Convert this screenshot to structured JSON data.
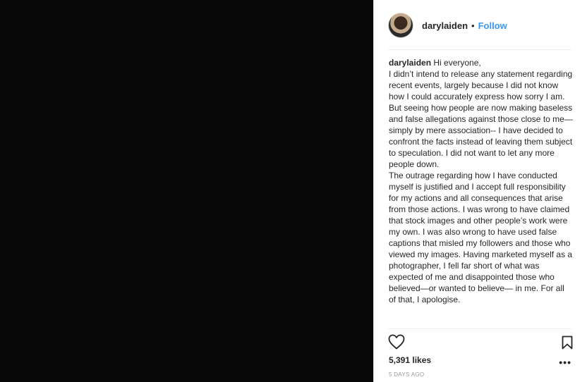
{
  "post": {
    "username": "darylaiden",
    "separator": "•",
    "follow_label": "Follow",
    "caption_username": "darylaiden",
    "caption_paragraphs": [
      "Hi everyone,",
      "I didn’t intend to release any statement regarding recent events, largely because I did not know how I could accurately express how sorry I am. But seeing how people are now making baseless and false allegations against those close to me—simply by mere association-- I have decided to confront the facts instead of leaving them subject to speculation. I did not want to let any more people down.",
      "The outrage regarding how I have conducted myself is justified and I accept full responsibility for my actions and all consequences that arise from those actions. I was wrong to have claimed that stock images and other people’s work were my own. I was also wrong to have used false captions that misled my followers and those who viewed my images. Having marketed myself as a photographer, I fell far short of what was expected of me and disappointed those who believed—or wanted to believe— in me. For all of that, I apologise."
    ],
    "likes": "5,391 likes",
    "timestamp": "5 DAYS AGO",
    "more_label": "•••"
  },
  "icons": {
    "heart": "heart-icon",
    "bookmark": "bookmark-icon"
  }
}
